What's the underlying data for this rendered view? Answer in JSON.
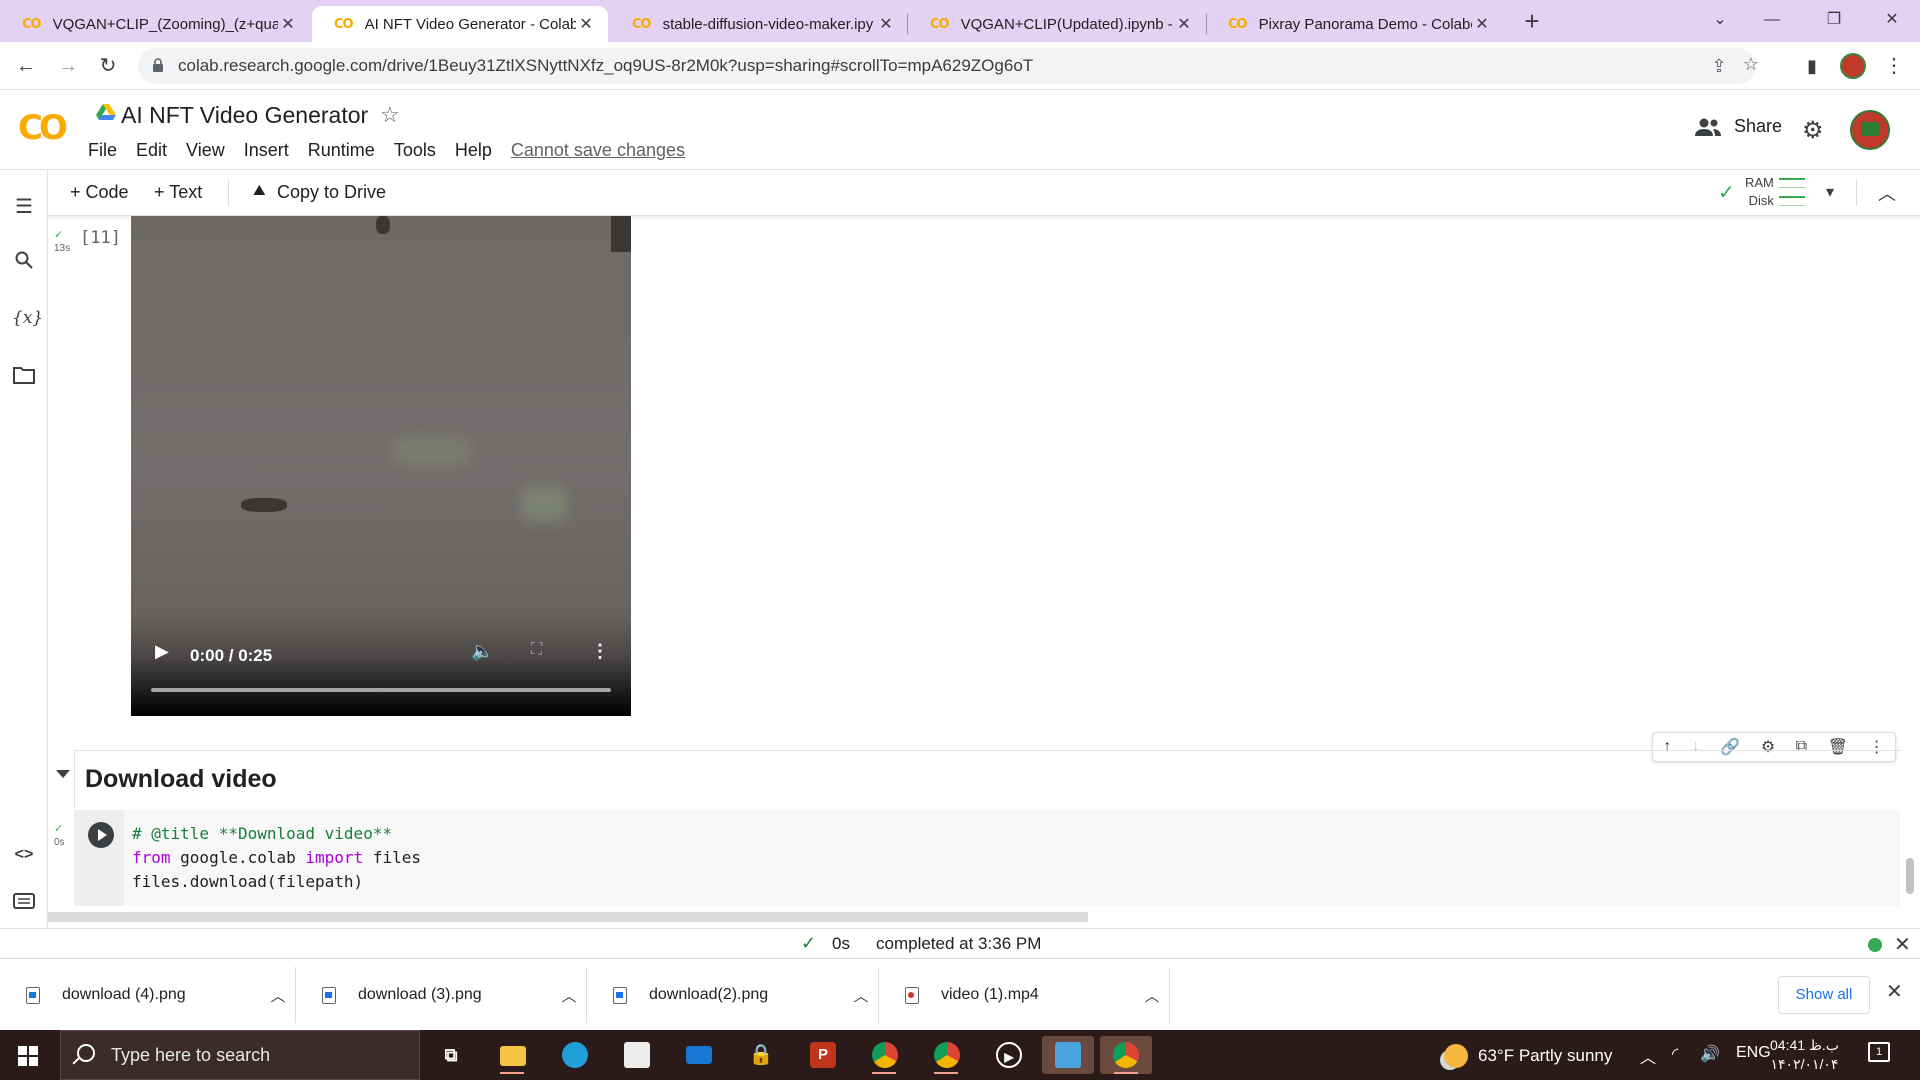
{
  "browser": {
    "tabs": [
      {
        "title": "VQGAN+CLIP_(Zooming)_(z+qua",
        "active": false
      },
      {
        "title": "AI NFT Video Generator - Colabo",
        "active": true
      },
      {
        "title": "stable-diffusion-video-maker.ipy",
        "active": false
      },
      {
        "title": "VQGAN+CLIP(Updated).ipynb - C",
        "active": false
      },
      {
        "title": "Pixray Panorama Demo - Colabo",
        "active": false
      }
    ],
    "tab_icon_text": "CO",
    "url": "colab.research.google.com/drive/1Beuy31ZtlXSNyttNXfz_oq9US-8r2M0k?usp=sharing#scrollTo=mpA629ZOg6oT"
  },
  "colab": {
    "logo_text": "CO",
    "title": "AI NFT Video Generator",
    "menu": [
      "File",
      "Edit",
      "View",
      "Insert",
      "Runtime",
      "Tools",
      "Help"
    ],
    "cannot_save": "Cannot save changes",
    "share_label": "Share"
  },
  "toolbar": {
    "code_label": "+ Code",
    "text_label": "+ Text",
    "copy_drive_label": "Copy to Drive",
    "ram_label": "RAM",
    "disk_label": "Disk"
  },
  "cells": {
    "output_cell": {
      "exec_count": "[11]",
      "duration": "13s"
    },
    "video": {
      "time": "0:00 / 0:25",
      "progress": 0.0
    },
    "section_title": "Download video",
    "code_cell": {
      "duration": "0s",
      "lines": [
        {
          "parts": [
            {
              "t": "# @title **Download video**",
              "c": "cm"
            }
          ]
        },
        {
          "parts": [
            {
              "t": "from",
              "c": "kw"
            },
            {
              "t": " google.colab ",
              "c": ""
            },
            {
              "t": "import",
              "c": "kw"
            },
            {
              "t": " files",
              "c": ""
            }
          ]
        },
        {
          "parts": [
            {
              "t": "files.download(filepath)",
              "c": ""
            }
          ]
        }
      ]
    }
  },
  "status": {
    "duration": "0s",
    "completed": "completed at 3:36 PM"
  },
  "downloads": {
    "items": [
      {
        "name": "download (4).png",
        "type": "image"
      },
      {
        "name": "download (3).png",
        "type": "image"
      },
      {
        "name": "download(2).png",
        "type": "image"
      },
      {
        "name": "video (1).mp4",
        "type": "video"
      }
    ],
    "show_all": "Show all"
  },
  "taskbar": {
    "search_placeholder": "Type here to search",
    "weather": "63°F  Partly sunny",
    "lang": "ENG",
    "time": "04:41 ب.ظ",
    "date": "۱۴۰۲/۰۱/۰۴",
    "notification_count": "1"
  },
  "colors": {
    "tab_strip": "#e3d2f3",
    "colab_orange": "#f9ab00",
    "success_green": "#34a853",
    "link_blue": "#1a73e8",
    "taskbar": "#2a1a1a"
  }
}
